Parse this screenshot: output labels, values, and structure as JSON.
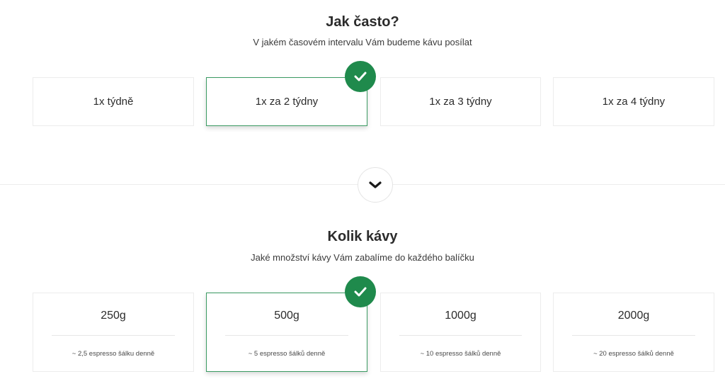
{
  "frequency": {
    "title": "Jak často?",
    "subtitle": "V jakém časovém intervalu Vám budeme kávu posílat",
    "options": [
      {
        "label": "1x týdně",
        "selected": false
      },
      {
        "label": "1x za 2 týdny",
        "selected": true
      },
      {
        "label": "1x za 3 týdny",
        "selected": false
      },
      {
        "label": "1x za 4 týdny",
        "selected": false
      }
    ]
  },
  "quantity": {
    "title": "Kolik kávy",
    "subtitle": "Jaké množství kávy Vám zabalíme do každého balíčku",
    "options": [
      {
        "amount": "250g",
        "desc": "~ 2,5 espresso šálku denně",
        "selected": false
      },
      {
        "amount": "500g",
        "desc": "~ 5 espresso šálků denně",
        "selected": true
      },
      {
        "amount": "1000g",
        "desc": "~ 10 espresso šálků denně",
        "selected": false
      },
      {
        "amount": "2000g",
        "desc": "~ 20 espresso šálků denně",
        "selected": false
      }
    ]
  },
  "icons": {
    "selected_check": "check-icon",
    "expand": "chevron-down-icon"
  },
  "colors": {
    "accent": "#1f8a4c",
    "selected_border": "#3a9a62",
    "card_border": "#ececec"
  }
}
